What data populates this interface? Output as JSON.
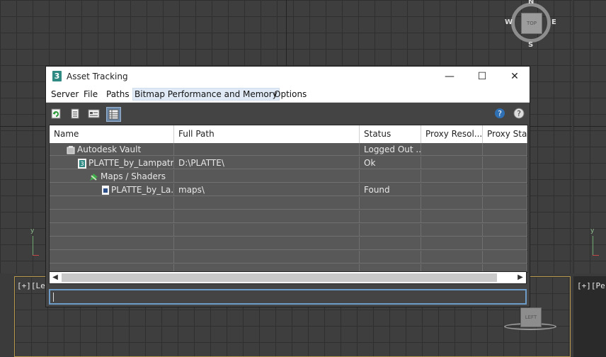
{
  "window": {
    "title": "Asset Tracking"
  },
  "window_controls": {
    "minimize": "—",
    "maximize": "☐",
    "close": "✕"
  },
  "menus": [
    "Server",
    "File",
    "Paths",
    "Bitmap Performance and Memory",
    "Options"
  ],
  "columns": [
    "Name",
    "Full Path",
    "Status",
    "Proxy Resol...",
    "Proxy Statu"
  ],
  "rows": [
    {
      "name": "Autodesk Vault",
      "path": "",
      "status": "Logged Out ..."
    },
    {
      "name": "PLATTE_by_Lampatr...",
      "path": "D:\\PLATTE\\",
      "status": "Ok"
    },
    {
      "name": "Maps / Shaders",
      "path": "",
      "status": ""
    },
    {
      "name": "PLATTE_by_La...",
      "path": "maps\\",
      "status": "Found"
    }
  ],
  "viewports": {
    "left_label": "[+][Le",
    "persp_label": "[+][Pe"
  },
  "viewcube": {
    "top_face": "TOP",
    "left_face": "LEFT",
    "n": "N",
    "s": "S",
    "e": "E",
    "w": "W"
  },
  "axis": {
    "y": "y"
  },
  "app_icon_glyph": "3",
  "colors": {
    "accent": "#6d9cc8",
    "dialog_bg": "#444444",
    "grid_bg": "#3e3e3e"
  }
}
